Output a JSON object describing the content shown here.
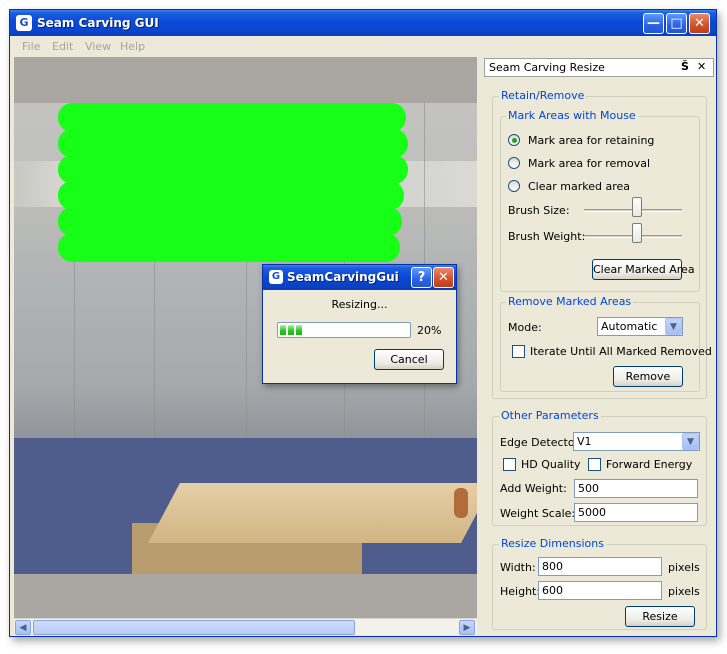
{
  "window": {
    "title": "Seam Carving GUI",
    "icon": "app-g-icon"
  },
  "menu": [
    "File",
    "Edit",
    "View",
    "Help"
  ],
  "dock": {
    "title": "Seam Carving Resize",
    "controls": [
      "Š",
      "✕"
    ],
    "retain_remove": {
      "legend": "Retain/Remove",
      "mark_areas": {
        "legend": "Mark Areas with Mouse",
        "options": [
          "Mark area for retaining",
          "Mark area for removal",
          "Clear marked area"
        ],
        "selected": 0,
        "brush_size_label": "Brush Size:",
        "brush_size_level": 0.55,
        "brush_weight_label": "Brush Weight:",
        "brush_weight_level": 0.55,
        "clear_button": "Clear Marked Area"
      },
      "remove_marked": {
        "legend": "Remove Marked Areas",
        "mode_label": "Mode:",
        "mode_value": "Automatic",
        "iterate_label": "Iterate Until All Marked Removed",
        "iterate_checked": false,
        "remove_button": "Remove"
      }
    },
    "other_params": {
      "legend": "Other Parameters",
      "edge_label": "Edge Detector:",
      "edge_value": "V1",
      "hd_label": "HD Quality",
      "hd_checked": false,
      "forward_label": "Forward Energy",
      "forward_checked": false,
      "add_weight_label": "Add Weight:",
      "add_weight_value": "500",
      "weight_scale_label": "Weight Scale:",
      "weight_scale_value": "5000"
    },
    "resize_dims": {
      "legend": "Resize Dimensions",
      "width_label": "Width:",
      "width_value": "800",
      "height_label": "Height:",
      "height_value": "600",
      "unit": "pixels",
      "resize_button": "Resize"
    }
  },
  "dialog": {
    "title": "SeamCarvingGui",
    "message": "Resizing...",
    "progress_percent": 20,
    "progress_text": "20%",
    "cancel_button": "Cancel"
  },
  "colors": {
    "accent": "#0046d5",
    "marked_retain": "#17ff17",
    "titlebar": "#0a4ad8"
  }
}
